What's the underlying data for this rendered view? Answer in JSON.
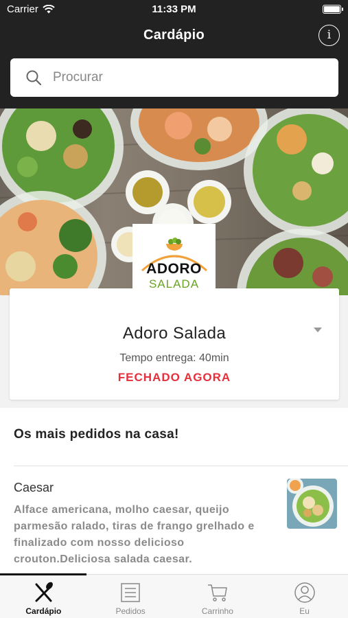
{
  "status_bar": {
    "carrier": "Carrier",
    "time": "11:33 PM"
  },
  "nav": {
    "title": "Cardápio",
    "info_icon": "info-icon"
  },
  "search": {
    "placeholder": "Procurar",
    "value": ""
  },
  "restaurant": {
    "logo_line1": "ADORO",
    "logo_line2": "SALADA",
    "name": "Adoro Salada",
    "delivery_time": "Tempo entrega: 40min",
    "status": "FECHADO AGORA",
    "status_color": "#e5303c"
  },
  "section": {
    "title": "Os mais pedidos na casa!"
  },
  "items": [
    {
      "name": "Caesar",
      "description": "Alface americana, molho caesar, queijo parmesão ralado, tiras de frango grelhado e finalizado com nosso delicioso crouton.Deliciosa salada caesar."
    }
  ],
  "tabs": [
    {
      "label": "Cardápio",
      "icon": "fork-knife-icon",
      "active": true
    },
    {
      "label": "Pedidos",
      "icon": "list-icon",
      "active": false
    },
    {
      "label": "Carrinho",
      "icon": "cart-icon",
      "active": false
    },
    {
      "label": "Eu",
      "icon": "user-icon",
      "active": false
    }
  ],
  "colors": {
    "header": "#222222",
    "accent_red": "#e5303c",
    "brand_green": "#6aa323"
  }
}
